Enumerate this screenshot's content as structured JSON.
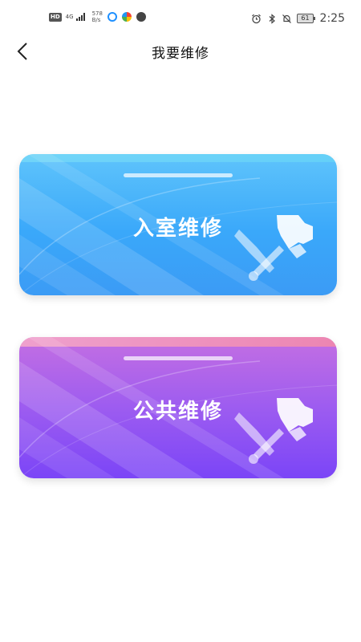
{
  "status_bar": {
    "hd": "HD",
    "network": "4G",
    "speed_value": "578",
    "speed_unit": "B/s",
    "battery": "61",
    "time": "2:25"
  },
  "header": {
    "title": "我要维修"
  },
  "cards": [
    {
      "label": "入室维修",
      "accent": "#3aa8fa"
    },
    {
      "label": "公共维修",
      "accent": "#8b4ff4"
    }
  ],
  "colors": {
    "background": "#ffffff",
    "blue_card": "#3aa8fa",
    "purple_card": "#7b45f7"
  },
  "icons": {
    "back": "chevron-left-icon",
    "card_decoration": "wrench-hammer-icon"
  }
}
